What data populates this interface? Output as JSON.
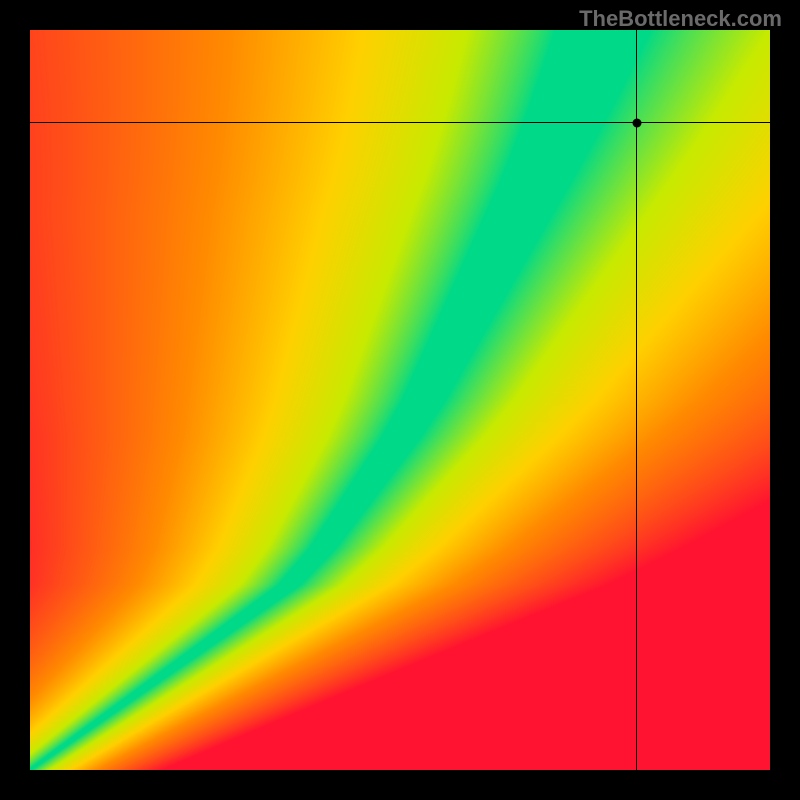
{
  "watermark": "TheBottleneck.com",
  "chart_data": {
    "type": "heatmap",
    "title": "",
    "xlabel": "",
    "ylabel": "",
    "xlim": [
      0,
      1
    ],
    "ylim": [
      0,
      1
    ],
    "colormap": "green-yellow-orange-red (traffic-light)",
    "colormap_stops": [
      {
        "t": 0.0,
        "hex": "#00d988"
      },
      {
        "t": 0.18,
        "hex": "#c7ea00"
      },
      {
        "t": 0.35,
        "hex": "#ffd000"
      },
      {
        "t": 0.55,
        "hex": "#ff8a00"
      },
      {
        "t": 0.8,
        "hex": "#ff4a1a"
      },
      {
        "t": 1.0,
        "hex": "#ff1330"
      }
    ],
    "optimal_ridge": {
      "description": "x-position of the green ridge (optimal balance curve) as a function of y, normalized 0..1; shape ≈ piecewise-linear with a knee near y≈0.25",
      "points": [
        {
          "y": 0.0,
          "x": 0.0
        },
        {
          "y": 0.05,
          "x": 0.07
        },
        {
          "y": 0.1,
          "x": 0.14
        },
        {
          "y": 0.15,
          "x": 0.21
        },
        {
          "y": 0.2,
          "x": 0.28
        },
        {
          "y": 0.25,
          "x": 0.35
        },
        {
          "y": 0.3,
          "x": 0.395
        },
        {
          "y": 0.35,
          "x": 0.43
        },
        {
          "y": 0.4,
          "x": 0.465
        },
        {
          "y": 0.45,
          "x": 0.5
        },
        {
          "y": 0.5,
          "x": 0.53
        },
        {
          "y": 0.55,
          "x": 0.555
        },
        {
          "y": 0.6,
          "x": 0.58
        },
        {
          "y": 0.65,
          "x": 0.605
        },
        {
          "y": 0.7,
          "x": 0.63
        },
        {
          "y": 0.75,
          "x": 0.655
        },
        {
          "y": 0.8,
          "x": 0.68
        },
        {
          "y": 0.85,
          "x": 0.703
        },
        {
          "y": 0.9,
          "x": 0.725
        },
        {
          "y": 0.95,
          "x": 0.745
        },
        {
          "y": 1.0,
          "x": 0.765
        }
      ]
    },
    "ridge_halfwidth": {
      "description": "approximate half-width of the green band (where color is fully green) as a function of y, normalized units",
      "points": [
        {
          "y": 0.0,
          "w": 0.003
        },
        {
          "y": 0.2,
          "w": 0.012
        },
        {
          "y": 0.4,
          "w": 0.022
        },
        {
          "y": 0.6,
          "w": 0.032
        },
        {
          "y": 0.8,
          "w": 0.042
        },
        {
          "y": 1.0,
          "w": 0.055
        }
      ]
    },
    "falloff_scale": {
      "description": "distance from ridge at which color reaches full red, normalized units, as a function of y",
      "points": [
        {
          "y": 0.0,
          "s": 0.18
        },
        {
          "y": 0.25,
          "s": 0.4
        },
        {
          "y": 0.5,
          "s": 0.62
        },
        {
          "y": 0.75,
          "s": 0.8
        },
        {
          "y": 1.0,
          "s": 0.95
        }
      ]
    },
    "marker": {
      "x": 0.82,
      "y": 0.875
    }
  }
}
